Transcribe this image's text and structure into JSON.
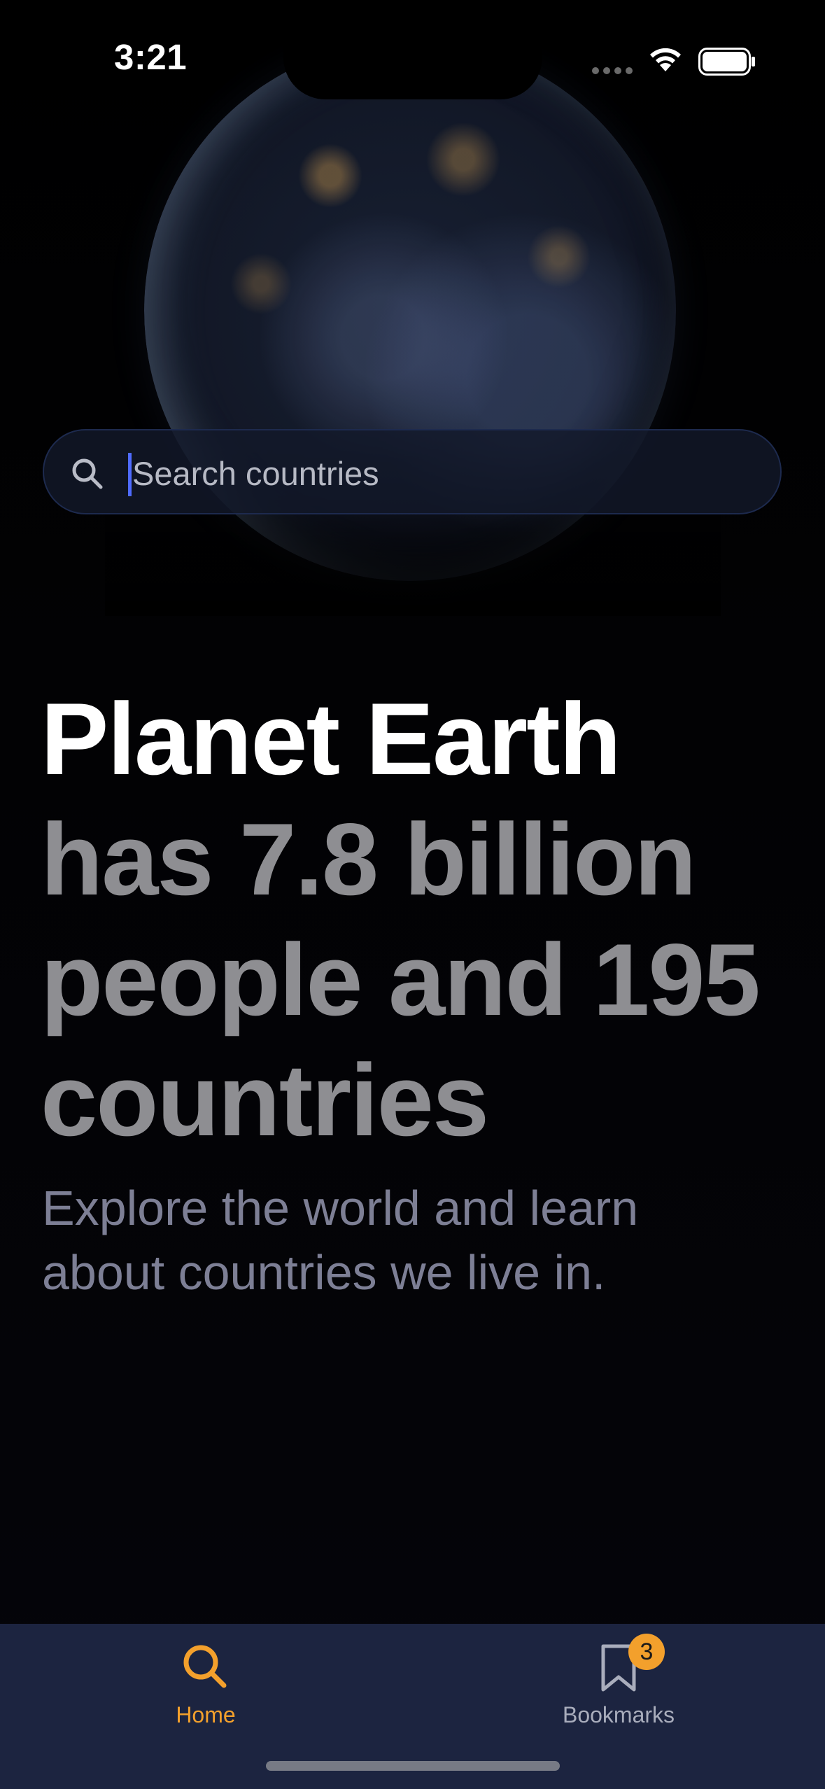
{
  "status_bar": {
    "time": "3:21"
  },
  "search": {
    "placeholder": "Search countries",
    "value": ""
  },
  "headline": {
    "strong": "Planet Earth",
    "muted": "has 7.8 billion people and 195 countries"
  },
  "subtitle": "Explore the world and learn about countries we live in.",
  "tab_bar": {
    "tabs": [
      {
        "label": "Home",
        "icon": "search-icon",
        "selected": true
      },
      {
        "label": "Bookmarks",
        "icon": "bookmark-icon",
        "selected": false,
        "badge": "3"
      }
    ]
  },
  "colors": {
    "accent": "#f3a02c",
    "tab_bar_background": "#1c2440",
    "muted_text": "#8e8e92",
    "caret": "#4f6bff"
  }
}
